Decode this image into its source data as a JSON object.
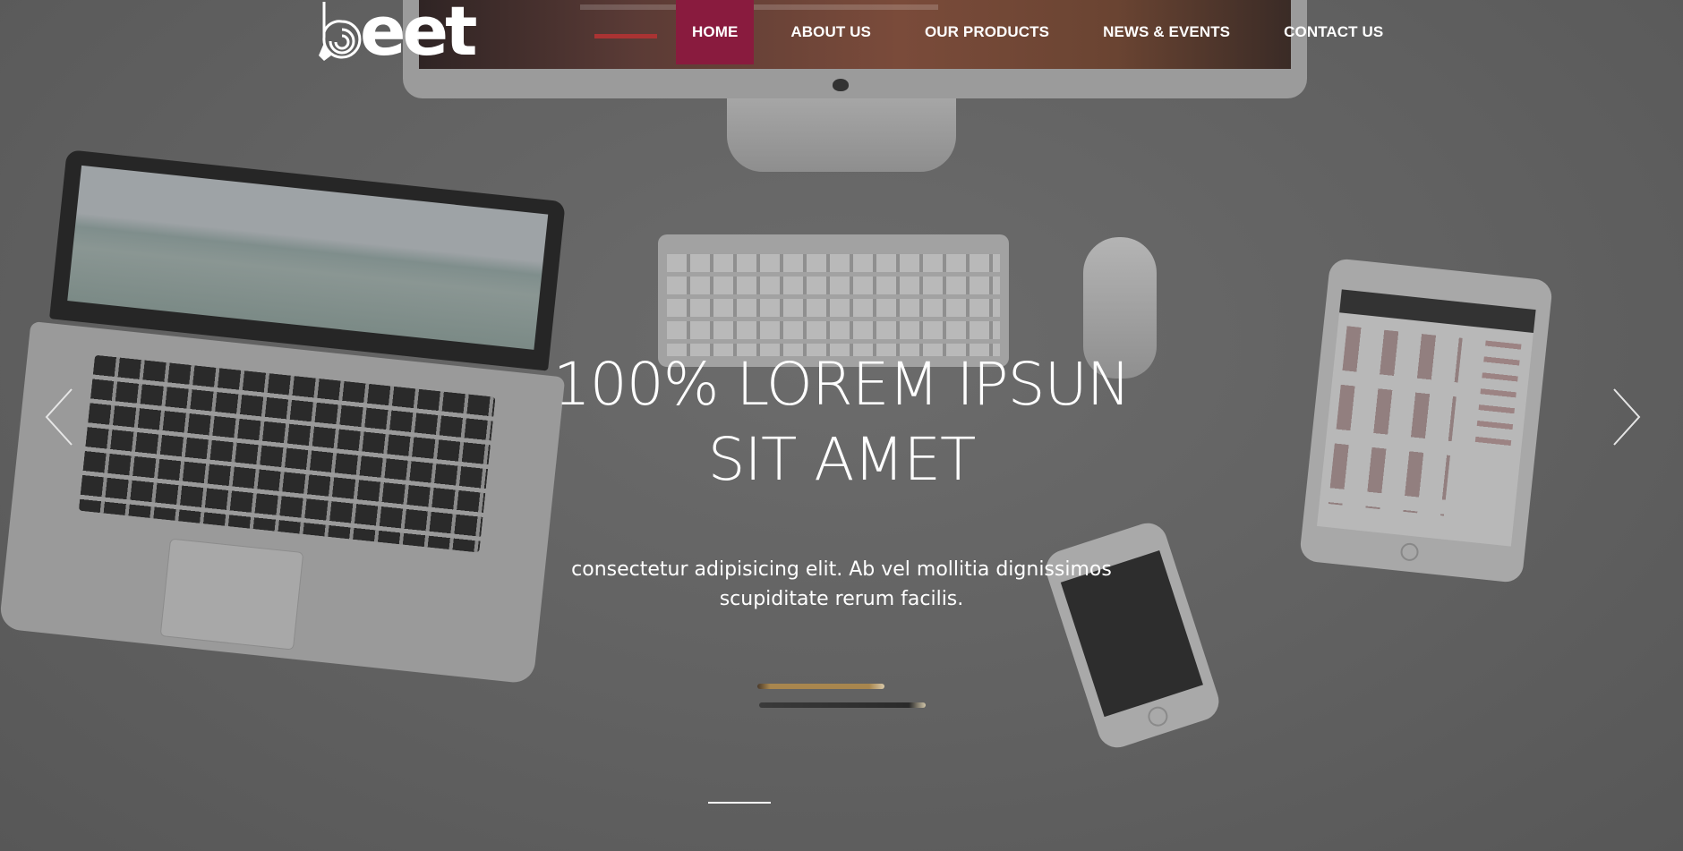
{
  "brand": {
    "logo_text": "eet",
    "accent_color": "#891b3e"
  },
  "nav": {
    "items": [
      {
        "label": "HOME",
        "active": true
      },
      {
        "label": "ABOUT US",
        "active": false
      },
      {
        "label": "OUR PRODUCTS",
        "active": false
      },
      {
        "label": "NEWS & EVENTS",
        "active": false
      },
      {
        "label": "CONTACT US",
        "active": false
      }
    ]
  },
  "slider": {
    "headline_line1": "100% LOREM IPSUN",
    "headline_line2": "SIT AMET",
    "subtext": "consectetur adipisicing elit. Ab vel mollitia dignissimos scupiditate rerum facilis.",
    "prev_icon": "chevron-left-icon",
    "next_icon": "chevron-right-icon"
  }
}
